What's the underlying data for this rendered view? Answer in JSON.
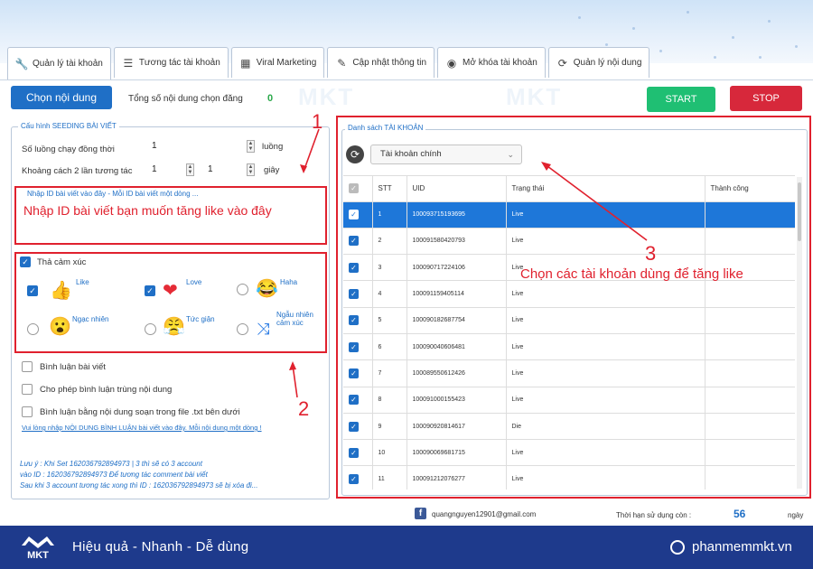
{
  "tabs": [
    {
      "label": "Quản lý tài khoản",
      "icon": "wrench-icon"
    },
    {
      "label": "Tương tác tài khoản",
      "icon": "list-icon"
    },
    {
      "label": "Viral Marketing",
      "icon": "calendar-icon"
    },
    {
      "label": "Cập nhật thông tin",
      "icon": "pencil-icon"
    },
    {
      "label": "Mở khóa tài khoản",
      "icon": "unlock-icon"
    },
    {
      "label": "Quản lý nội dung",
      "icon": "refresh-icon"
    }
  ],
  "toolbar": {
    "choose_content": "Chọn nội dung",
    "count_label": "Tổng số nội dung chọn đăng",
    "count_value": "0",
    "start": "START",
    "stop": "STOP"
  },
  "watermark": "MKT",
  "seeding": {
    "legend": "Cấu hình SEEDING BÀI VIẾT",
    "threads_label": "Số luồng chạy đồng thời",
    "threads_value": "1",
    "threads_unit": "luồng",
    "interval_label": "Khoảng cách 2 lần tương tác",
    "interval_from": "1",
    "interval_to": "1",
    "interval_unit": "giây",
    "post_id_placeholder": "Nhập ID bài viết vào đây - Mỗi ID bài viết một dòng ...",
    "post_id_annotation": "Nhập ID bài viết bạn muốn tăng like vào đây"
  },
  "reactions": {
    "label": "Thả cảm xúc",
    "items": [
      {
        "name": "Like",
        "checked": true,
        "glyph": "👍"
      },
      {
        "name": "Love",
        "checked": true,
        "glyph": "❤"
      },
      {
        "name": "Haha",
        "checked": false,
        "glyph": "😂"
      },
      {
        "name": "Ngạc nhiên",
        "checked": false,
        "glyph": "😮"
      },
      {
        "name": "Tức giận",
        "checked": false,
        "glyph": "😤"
      },
      {
        "name": "Ngẫu nhiên cảm xúc",
        "checked": false,
        "glyph": "⤨"
      }
    ]
  },
  "options": {
    "comment": "Bình luận bài viết",
    "allow_duplicate": "Cho phép bình luận trùng nội dung",
    "comment_from_file": "Bình luận bằng nội dung soạn trong file .txt bên dưới",
    "link": "Vui lòng nhập NỘI DUNG BÌNH LUẬN bài viết vào đây. Mỗi nội dung một dòng !"
  },
  "notes": [
    "Lưu ý : Khi Set 162036792894973 | 3 thì sẽ có 3 account",
    "vào ID : 162036792894973 Để tương tác comment bài viết",
    "Sau khi 3 account tương tác xong thì ID : 162036792894973 sẽ bị xóa đi..."
  ],
  "annotations": {
    "one": "1",
    "two": "2",
    "three": "3",
    "accounts_note": "Chọn các tài khoản dùng để tăng like"
  },
  "accounts": {
    "legend": "Danh sách TÀI KHOẢN",
    "select_value": "Tài khoản chính",
    "columns": [
      "",
      "STT",
      "UID",
      "Trạng thái",
      "Thành công"
    ],
    "rows": [
      {
        "stt": "1",
        "uid": "100093715193695",
        "status": "Live",
        "selected": true
      },
      {
        "stt": "2",
        "uid": "100091580420793",
        "status": "Live",
        "selected": false
      },
      {
        "stt": "3",
        "uid": "100090717224106",
        "status": "Live",
        "selected": false
      },
      {
        "stt": "4",
        "uid": "100091159405114",
        "status": "Live",
        "selected": false
      },
      {
        "stt": "5",
        "uid": "100090182687754",
        "status": "Live",
        "selected": false
      },
      {
        "stt": "6",
        "uid": "100090040606481",
        "status": "Live",
        "selected": false
      },
      {
        "stt": "7",
        "uid": "100089550612426",
        "status": "Live",
        "selected": false
      },
      {
        "stt": "8",
        "uid": "100091000155423",
        "status": "Live",
        "selected": false
      },
      {
        "stt": "9",
        "uid": "100090920814617",
        "status": "Die",
        "selected": false
      },
      {
        "stt": "10",
        "uid": "100090069681715",
        "status": "Live",
        "selected": false
      },
      {
        "stt": "11",
        "uid": "100091212076277",
        "status": "Live",
        "selected": false
      }
    ]
  },
  "status_bar": {
    "email": "quangnguyen12901@gmail.com",
    "days_label": "Thời hạn sử dụng còn :",
    "days_value": "56",
    "days_unit": "ngày"
  },
  "footer": {
    "brand": "MKT",
    "slogan": "Hiệu quả - Nhanh  - Dễ dùng",
    "site": "phanmemmkt.vn"
  }
}
